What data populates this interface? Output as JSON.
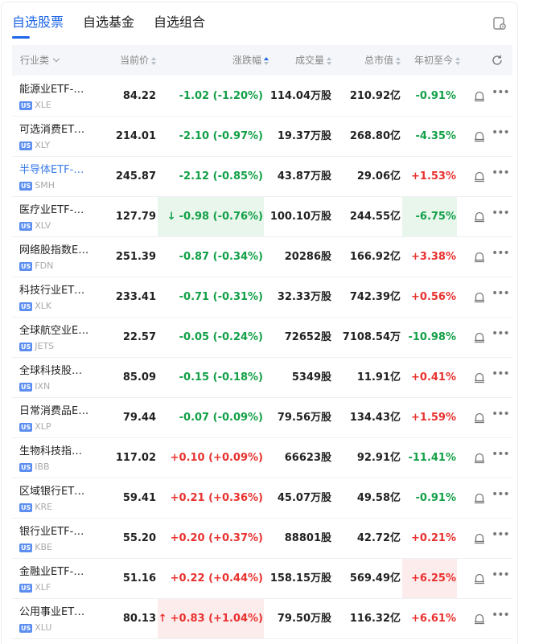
{
  "tabs": [
    {
      "label": "自选股票",
      "active": true
    },
    {
      "label": "自选基金",
      "active": false
    },
    {
      "label": "自选组合",
      "active": false
    }
  ],
  "columns": {
    "category": "行业类",
    "price": "当前价",
    "change": "涨跌幅",
    "volume": "成交量",
    "mcap": "总市值",
    "ytd": "年初至今"
  },
  "colors": {
    "up": "#e8322f",
    "down": "#13a048",
    "accent": "#1e66e6",
    "up_bg": "#fdecec",
    "down_bg": "#e8f6ec"
  },
  "rows": [
    {
      "name": "能源业ETF-…",
      "ticker": "XLE",
      "price": "84.22",
      "change": "-1.02 (-1.20%)",
      "dir": "down",
      "volume": "114.04万股",
      "mcap": "210.92亿",
      "ytd": "-0.91%",
      "ytd_dir": "down"
    },
    {
      "name": "可选消费ET…",
      "ticker": "XLY",
      "price": "214.01",
      "change": "-2.10 (-0.97%)",
      "dir": "down",
      "volume": "19.37万股",
      "mcap": "268.80亿",
      "ytd": "-4.35%",
      "ytd_dir": "down"
    },
    {
      "name": "半导体ETF-…",
      "ticker": "SMH",
      "price": "245.87",
      "change": "-2.12 (-0.85%)",
      "dir": "down",
      "volume": "43.87万股",
      "mcap": "29.06亿",
      "ytd": "+1.53%",
      "ytd_dir": "up",
      "link": true
    },
    {
      "name": "医疗业ETF-…",
      "ticker": "XLV",
      "price": "127.79",
      "change": "-0.98 (-0.76%)",
      "dir": "down",
      "volume": "100.10万股",
      "mcap": "244.55亿",
      "ytd": "-6.75%",
      "ytd_dir": "down",
      "arrow": "↓",
      "change_hl": true,
      "ytd_hl": true
    },
    {
      "name": "网络股指数E…",
      "ticker": "FDN",
      "price": "251.39",
      "change": "-0.87 (-0.34%)",
      "dir": "down",
      "volume": "20286股",
      "mcap": "166.92亿",
      "ytd": "+3.38%",
      "ytd_dir": "up"
    },
    {
      "name": "科技行业ET…",
      "ticker": "XLK",
      "price": "233.41",
      "change": "-0.71 (-0.31%)",
      "dir": "down",
      "volume": "32.33万股",
      "mcap": "742.39亿",
      "ytd": "+0.56%",
      "ytd_dir": "up"
    },
    {
      "name": "全球航空业E…",
      "ticker": "JETS",
      "price": "22.57",
      "change": "-0.05 (-0.24%)",
      "dir": "down",
      "volume": "72652股",
      "mcap": "7108.54万",
      "ytd": "-10.98%",
      "ytd_dir": "down"
    },
    {
      "name": "全球科技股…",
      "ticker": "IXN",
      "price": "85.09",
      "change": "-0.15 (-0.18%)",
      "dir": "down",
      "volume": "5349股",
      "mcap": "11.91亿",
      "ytd": "+0.41%",
      "ytd_dir": "up"
    },
    {
      "name": "日常消费品E…",
      "ticker": "XLP",
      "price": "79.44",
      "change": "-0.07 (-0.09%)",
      "dir": "down",
      "volume": "79.56万股",
      "mcap": "134.43亿",
      "ytd": "+1.59%",
      "ytd_dir": "up"
    },
    {
      "name": "生物科技指…",
      "ticker": "IBB",
      "price": "117.02",
      "change": "+0.10 (+0.09%)",
      "dir": "up",
      "volume": "66623股",
      "mcap": "92.91亿",
      "ytd": "-11.41%",
      "ytd_dir": "down"
    },
    {
      "name": "区域银行ET…",
      "ticker": "KRE",
      "price": "59.41",
      "change": "+0.21 (+0.36%)",
      "dir": "up",
      "volume": "45.07万股",
      "mcap": "49.58亿",
      "ytd": "-0.91%",
      "ytd_dir": "down"
    },
    {
      "name": "银行业ETF-…",
      "ticker": "KBE",
      "price": "55.20",
      "change": "+0.20 (+0.37%)",
      "dir": "up",
      "volume": "88801股",
      "mcap": "42.72亿",
      "ytd": "+0.21%",
      "ytd_dir": "up"
    },
    {
      "name": "金融业ETF-…",
      "ticker": "XLF",
      "price": "51.16",
      "change": "+0.22 (+0.44%)",
      "dir": "up",
      "volume": "158.15万股",
      "mcap": "569.49亿",
      "ytd": "+6.25%",
      "ytd_dir": "up",
      "ytd_hl": true
    },
    {
      "name": "公用事业ET…",
      "ticker": "XLU",
      "price": "80.13",
      "change": "+0.83 (+1.04%)",
      "dir": "up",
      "volume": "79.50万股",
      "mcap": "116.32亿",
      "ytd": "+6.61%",
      "ytd_dir": "up",
      "arrow": "↑",
      "change_hl": true
    }
  ]
}
